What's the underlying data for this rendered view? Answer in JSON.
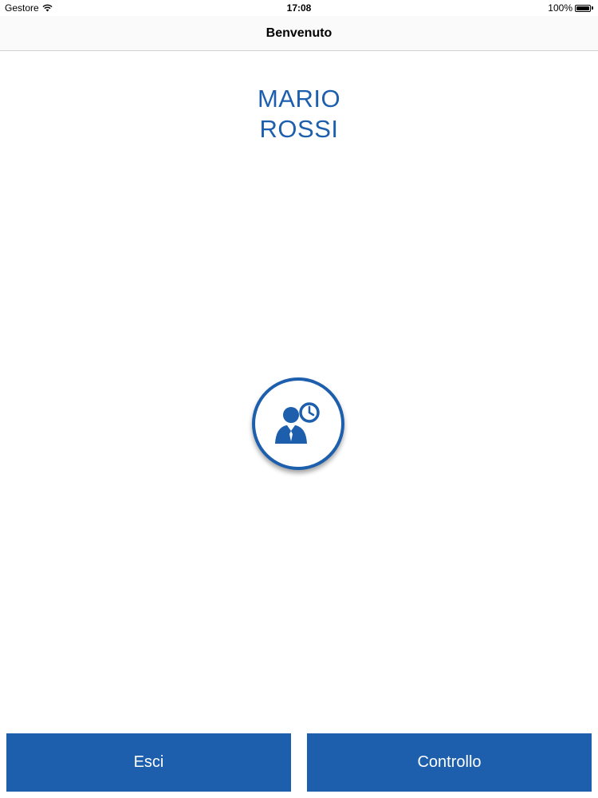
{
  "status_bar": {
    "carrier": "Gestore",
    "time": "17:08",
    "battery": "100%",
    "icons": [
      "wifi-icon",
      "battery-icon"
    ]
  },
  "nav": {
    "title": "Benvenuto"
  },
  "user": {
    "first_name": "MARIO",
    "last_name": "ROSSI"
  },
  "center_button": {
    "icon": "user-clock-icon"
  },
  "actions": {
    "exit_label": "Esci",
    "check_label": "Controllo"
  },
  "colors": {
    "accent": "#1d5fad",
    "background": "#ffffff",
    "button_text": "#ffffff"
  }
}
